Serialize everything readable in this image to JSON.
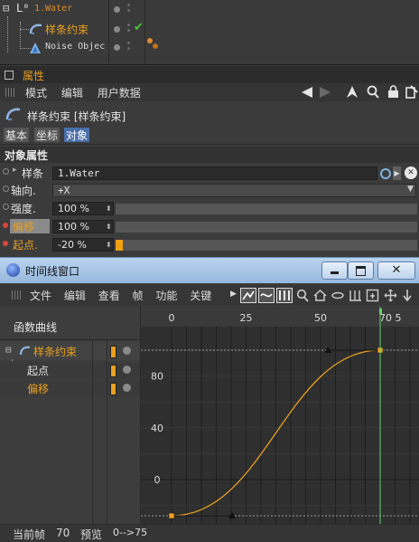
{
  "object_manager": {
    "root_label": "1.Water",
    "child1_label": "样条约束",
    "child2_label": "Noise Objec",
    "checkmark_glyph": "✔"
  },
  "attributes": {
    "title": "属性",
    "menu": [
      "模式",
      "编辑",
      "用户数据"
    ],
    "object_title": "样条约束 [样条约束]",
    "tabs": [
      "基本",
      "坐标",
      "对象"
    ],
    "active_tab": "对象",
    "section_title": "对象属性",
    "params": {
      "spline": {
        "label": "样条",
        "value": "1.Water"
      },
      "axis": {
        "label": "轴向.",
        "value": "+X"
      },
      "strength": {
        "label": "强度.",
        "value": "100 %",
        "fill": 0
      },
      "offset": {
        "label": "偏移",
        "value": "100 %",
        "fill": 0
      },
      "start": {
        "label": "起点.",
        "value": "-20 %",
        "fill": 0.02
      }
    }
  },
  "timeline": {
    "title": "时间线窗口",
    "menu": [
      "文件",
      "编辑",
      "查看",
      "帧",
      "功能",
      "关键"
    ],
    "panel_title": "函数曲线",
    "tracks": [
      {
        "label": "样条约束",
        "color": "#e8a020"
      },
      {
        "label": "起点",
        "color": "#e0e0e0"
      },
      {
        "label": "偏移",
        "color": "#e8a020"
      }
    ],
    "ruler_ticks": [
      "0",
      "25",
      "50",
      "70",
      "5"
    ],
    "value_ticks": [
      "80",
      "40",
      "0"
    ],
    "current_frame_label": "当前帧",
    "current_frame": "70",
    "preview_label": "预览",
    "preview_range": "0-->75"
  },
  "chart_data": {
    "type": "line",
    "title": "",
    "xlabel": "",
    "ylabel": "",
    "x_ticks": [
      0,
      25,
      50,
      70
    ],
    "y_ticks": [
      0,
      40,
      80
    ],
    "current_frame": 70,
    "series": [
      {
        "name": "偏移",
        "color": "#e8a020",
        "keyframes": [
          {
            "x": 0,
            "y": -28
          },
          {
            "x": 70,
            "y": 100
          }
        ]
      }
    ]
  },
  "colors": {
    "accent_orange": "#e8a020",
    "playhead_green": "#5cd66a",
    "keyframe_red": "#d8453b",
    "panel_bg": "#3b3b3b",
    "graph_bg": "#2e2e2e",
    "title_bar_blue": "#9fc2e6"
  },
  "icons": [
    "back-arrow-icon",
    "forward-arrow-icon",
    "pointer-icon",
    "search-icon",
    "lock-icon",
    "settings-icon",
    "spline-icon",
    "noise-icon",
    "minimize-icon",
    "maximize-icon",
    "close-icon"
  ]
}
